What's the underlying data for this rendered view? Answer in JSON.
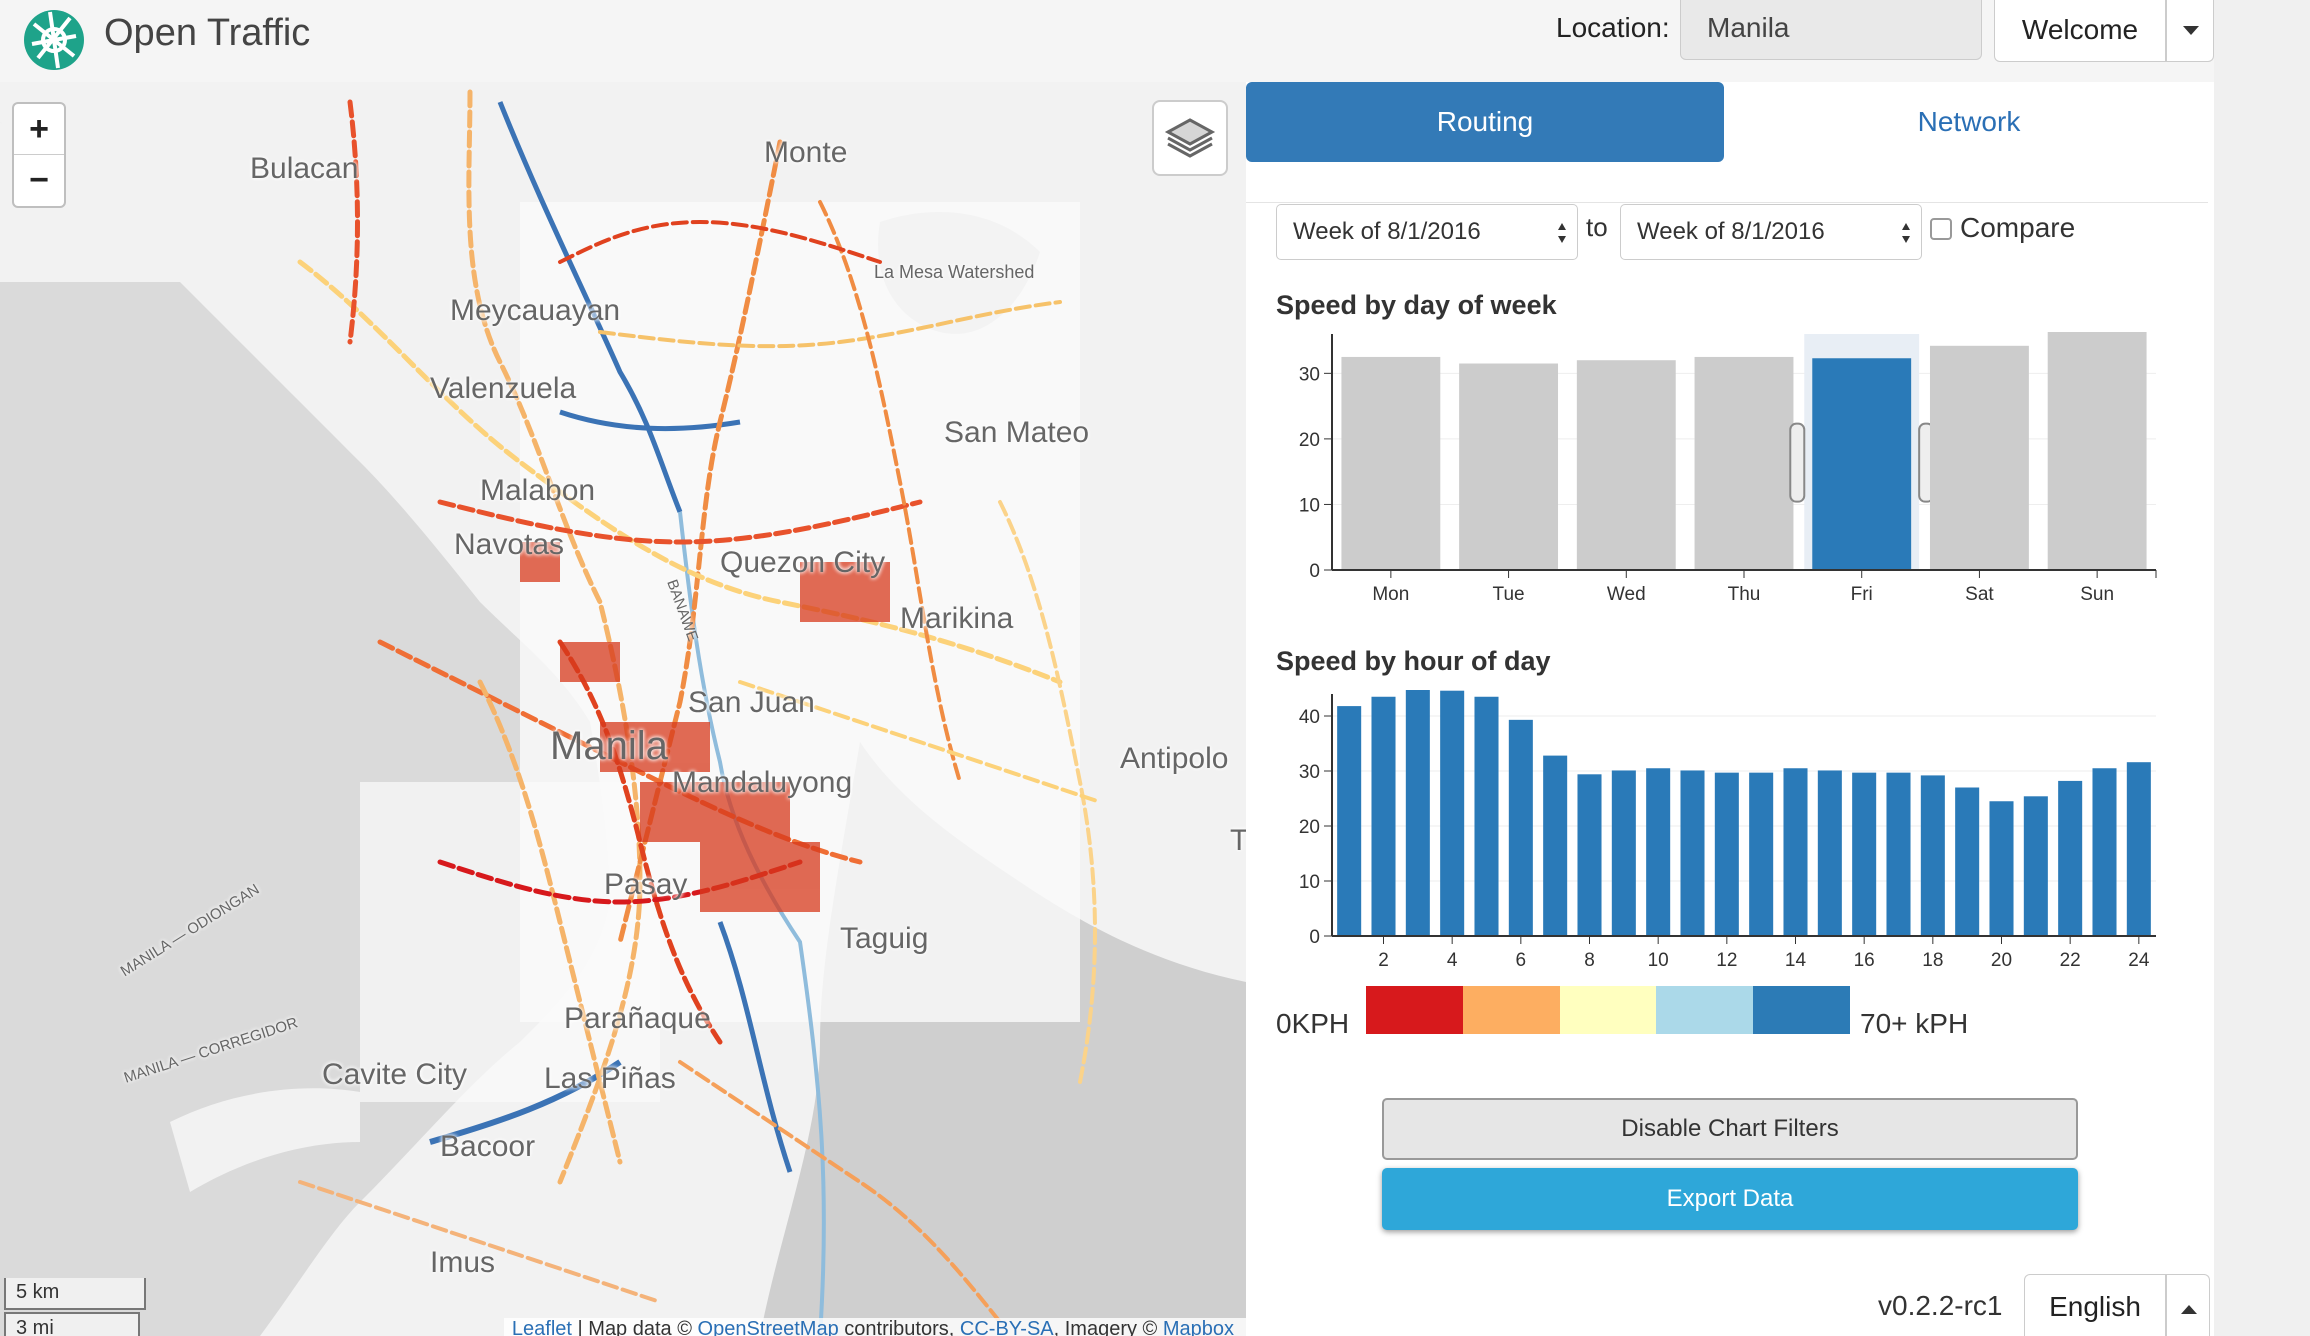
{
  "header": {
    "app_title": "Open Traffic",
    "location_label": "Location:",
    "location_value": "Manila",
    "welcome_label": "Welcome"
  },
  "map": {
    "zoom_in": "+",
    "zoom_out": "−",
    "scale_km": "5 km",
    "scale_mi": "3 mi",
    "labels": [
      "Bulacan",
      "Monte",
      "La Mesa Watershed",
      "Meycauayan",
      "Valenzuela",
      "San Mateo",
      "Malabon",
      "Navotas",
      "Quezon City",
      "Marikina",
      "San Juan",
      "Manila",
      "Mandaluyong",
      "Antipolo",
      "Pasay",
      "Taguig",
      "Parañaque",
      "Cavite City",
      "Las Piñas",
      "Bacoor",
      "Imus",
      "MANILA — ODIONGAN",
      "MANILA — CORREGIDOR",
      "BANAWE",
      "T"
    ],
    "attribution": {
      "leaflet": "Leaflet",
      "sep": " | Map data © ",
      "osm": "OpenStreetMap",
      "contrib": " contributors, ",
      "ccbysa": "CC-BY-SA",
      "imagery": ", Imagery © ",
      "mapbox": "Mapbox"
    }
  },
  "panel": {
    "tabs": [
      {
        "label": "Routing"
      },
      {
        "label": "Network"
      }
    ],
    "from_week": "Week of 8/1/2016",
    "to_label": "to",
    "to_week": "Week of 8/1/2016",
    "compare_label": "Compare",
    "legend_min": "0KPH",
    "legend_max": "70+ kPH",
    "legend_colors": [
      "#d7191c",
      "#fdae61",
      "#ffffbf",
      "#abd9e9",
      "#2c7bb6"
    ],
    "disable_filters": "Disable Chart Filters",
    "export": "Export Data",
    "version": "v0.2.2-rc1",
    "language": "English"
  },
  "chart_data": [
    {
      "type": "bar",
      "title": "Speed by day of week",
      "categories": [
        "Mon",
        "Tue",
        "Wed",
        "Thu",
        "Fri",
        "Sat",
        "Sun"
      ],
      "values": [
        32.5,
        31.5,
        32,
        32.5,
        32.3,
        34.2,
        36.6
      ],
      "selected": "Fri",
      "ylim": [
        0,
        36
      ],
      "yticks": [
        0,
        10,
        20,
        30
      ],
      "colors": {
        "default": "#cccccc",
        "selected": "#2a7ab8"
      }
    },
    {
      "type": "bar",
      "title": "Speed by hour of day",
      "x": [
        1,
        2,
        3,
        4,
        5,
        6,
        7,
        8,
        9,
        10,
        11,
        12,
        13,
        14,
        15,
        16,
        17,
        18,
        19,
        20,
        21,
        22,
        23
      ],
      "values": [
        41.8,
        43.5,
        44.8,
        44.6,
        43.5,
        39.3,
        32.8,
        29.4,
        30.1,
        30.5,
        30.1,
        29.7,
        29.7,
        30.5,
        30.1,
        29.7,
        29.7,
        29.2,
        27,
        24.5,
        25.4,
        28.2,
        30.5,
        31.6
      ],
      "xticks": [
        2,
        4,
        6,
        8,
        10,
        12,
        14,
        16,
        18,
        20,
        22,
        24
      ],
      "ylim": [
        0,
        44
      ],
      "yticks": [
        0,
        10,
        20,
        30,
        40
      ],
      "color": "#2a7ab8"
    }
  ]
}
